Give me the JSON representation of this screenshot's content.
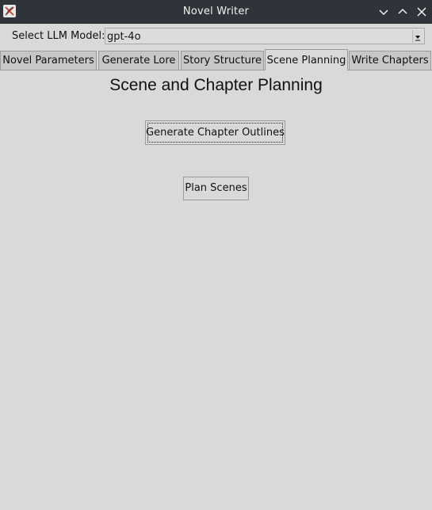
{
  "window": {
    "title": "Novel Writer",
    "icon": "feather-x-icon",
    "controls": [
      "minimize-icon",
      "maximize-icon",
      "close-icon"
    ]
  },
  "model_selector": {
    "label": "Select LLM Model:",
    "value": "gpt-4o"
  },
  "tabs": [
    {
      "label": "Novel Parameters",
      "active": false
    },
    {
      "label": "Generate Lore",
      "active": false
    },
    {
      "label": "Story Structure",
      "active": false
    },
    {
      "label": "Scene Planning",
      "active": true
    },
    {
      "label": "Write Chapters",
      "active": false
    }
  ],
  "panel": {
    "heading": "Scene and Chapter Planning",
    "buttons": {
      "generate_outlines": "Generate Chapter Outlines",
      "plan_scenes": "Plan Scenes"
    }
  },
  "colors": {
    "titlebar": "#2f343a",
    "background": "#d9d9d9",
    "tab_inactive": "#c7c7c7",
    "tab_active": "#d9d9d9"
  }
}
